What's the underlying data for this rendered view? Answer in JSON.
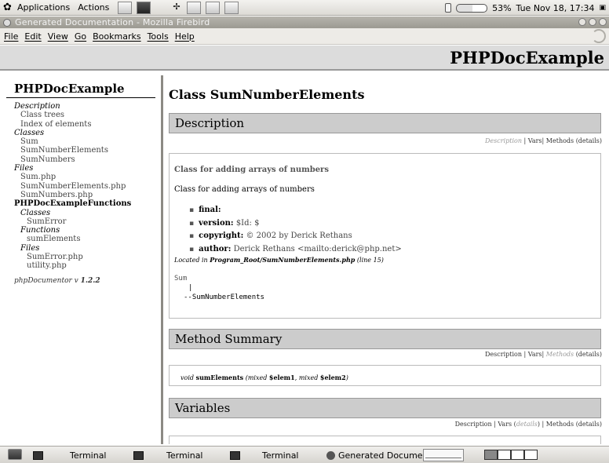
{
  "top_panel": {
    "applications": "Applications",
    "actions": "Actions",
    "battery": "53%",
    "clock": "Tue Nov 18, 17:34"
  },
  "window": {
    "title": "Generated Documentation - Mozilla Firebird"
  },
  "menubar": [
    "File",
    "Edit",
    "View",
    "Go",
    "Bookmarks",
    "Tools",
    "Help"
  ],
  "header": {
    "title": "PHPDocExample"
  },
  "nav": {
    "title": "PHPDocExample",
    "description_label": "Description",
    "description_items": [
      "Class trees",
      "Index of elements"
    ],
    "classes_label": "Classes",
    "classes": [
      "Sum",
      "SumNumberElements",
      "SumNumbers"
    ],
    "files_label": "Files",
    "files": [
      "Sum.php",
      "SumNumberElements.php",
      "SumNumbers.php"
    ],
    "package": "PHPDocExampleFunctions",
    "pkg_classes_label": "Classes",
    "pkg_classes": [
      "SumError"
    ],
    "pkg_functions_label": "Functions",
    "pkg_functions": [
      "sumElements"
    ],
    "pkg_files_label": "Files",
    "pkg_files": [
      "SumError.php",
      "utility.php"
    ],
    "version_prefix": "phpDocumentor v",
    "version": "1.2.2"
  },
  "content": {
    "class_title": "Class SumNumberElements",
    "description": {
      "heading": "Description",
      "short": "Class for adding arrays of numbers",
      "long": "Class for adding arrays of numbers",
      "tags": [
        {
          "name": "final:",
          "value": ""
        },
        {
          "name": "version:",
          "value": "$Id: $"
        },
        {
          "name": "copyright:",
          "value": "© 2002 by Derick Rethans"
        },
        {
          "name": "author:",
          "value": "Derick Rethans <mailto:derick@php.net>"
        }
      ],
      "located_prefix": "Located in",
      "located_file": "Program_Root/SumNumberElements.php",
      "located_line": "(line 15)",
      "tree_root": "Sum",
      "tree_pipe": "|",
      "tree_child": "--SumNumberElements"
    },
    "links": {
      "description": "Description",
      "vars": "Vars",
      "methods": "Methods",
      "details": "(details)",
      "details_word": "details",
      "sep": "|"
    },
    "method_summary": {
      "heading": "Method Summary",
      "return_type": "void",
      "name": "sumElements",
      "param1_type": "mixed",
      "param1": "$elem1",
      "param2_type": "mixed",
      "param2": "$elem2"
    },
    "variables": {
      "heading": "Variables"
    }
  },
  "taskbar": {
    "tasks": [
      "Terminal",
      "Terminal",
      "Terminal",
      "Generated Document:"
    ]
  }
}
